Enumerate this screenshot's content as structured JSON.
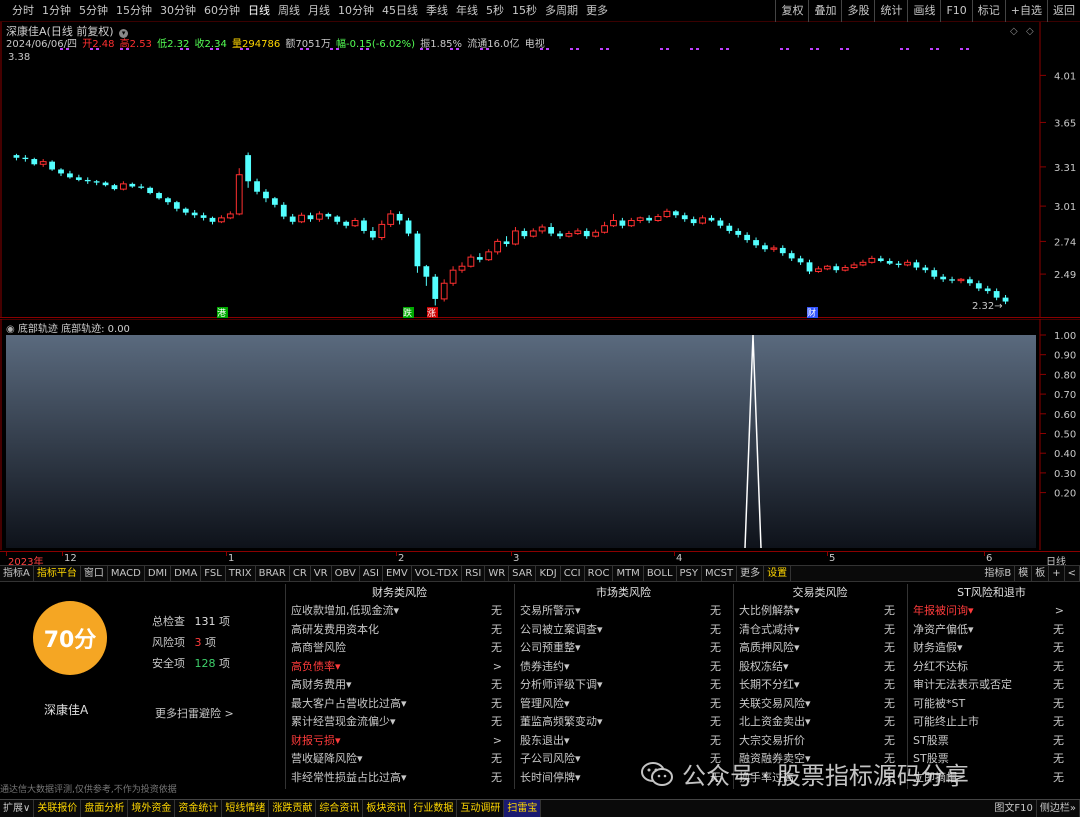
{
  "toolbar": {
    "periods": [
      "分时",
      "1分钟",
      "5分钟",
      "15分钟",
      "30分钟",
      "60分钟",
      "日线",
      "周线",
      "月线",
      "10分钟",
      "45日线",
      "季线",
      "年线",
      "5秒",
      "15秒",
      "多周期",
      "更多"
    ],
    "active_period": "日线",
    "right_buttons": [
      "复权",
      "叠加",
      "多股",
      "统计",
      "画线",
      "F10",
      "标记",
      "+自选",
      "返回"
    ]
  },
  "chart_header": {
    "title": "深康佳A(日线 前复权)",
    "date": "2024/06/06/四",
    "open": "开2.48",
    "high": "高2.53",
    "low": "低2.32",
    "close": "收2.34",
    "volume": "量294786",
    "amount": "额7051万",
    "change": "幅-0.15(-6.02%)",
    "turnover": "振1.85%",
    "float": "流通16.0亿",
    "tv": "电视",
    "first_label": "3.38",
    "last_label": "2.32"
  },
  "price_axis": [
    "4.01",
    "3.65",
    "3.31",
    "3.01",
    "2.74",
    "2.49"
  ],
  "markers": [
    "港",
    "跌",
    "涨",
    "财"
  ],
  "candles": [
    [
      3.4,
      3.38,
      3.41,
      3.36
    ],
    [
      3.38,
      3.37,
      3.4,
      3.35
    ],
    [
      3.37,
      3.33,
      3.38,
      3.32
    ],
    [
      3.33,
      3.35,
      3.37,
      3.31
    ],
    [
      3.35,
      3.29,
      3.36,
      3.28
    ],
    [
      3.29,
      3.26,
      3.3,
      3.24
    ],
    [
      3.26,
      3.23,
      3.28,
      3.22
    ],
    [
      3.23,
      3.21,
      3.25,
      3.2
    ],
    [
      3.21,
      3.2,
      3.23,
      3.18
    ],
    [
      3.2,
      3.19,
      3.21,
      3.17
    ],
    [
      3.19,
      3.17,
      3.2,
      3.16
    ],
    [
      3.17,
      3.14,
      3.18,
      3.13
    ],
    [
      3.14,
      3.18,
      3.2,
      3.13
    ],
    [
      3.18,
      3.16,
      3.19,
      3.15
    ],
    [
      3.16,
      3.15,
      3.18,
      3.14
    ],
    [
      3.15,
      3.11,
      3.16,
      3.1
    ],
    [
      3.11,
      3.07,
      3.12,
      3.06
    ],
    [
      3.07,
      3.04,
      3.08,
      3.02
    ],
    [
      3.04,
      2.99,
      3.05,
      2.97
    ],
    [
      2.99,
      2.96,
      3.0,
      2.94
    ],
    [
      2.96,
      2.94,
      2.98,
      2.92
    ],
    [
      2.94,
      2.92,
      2.96,
      2.9
    ],
    [
      2.92,
      2.89,
      2.93,
      2.87
    ],
    [
      2.89,
      2.92,
      2.94,
      2.88
    ],
    [
      2.92,
      2.95,
      2.97,
      2.91
    ],
    [
      2.95,
      3.25,
      3.3,
      2.94
    ],
    [
      3.4,
      3.2,
      3.42,
      3.15
    ],
    [
      3.2,
      3.12,
      3.22,
      3.1
    ],
    [
      3.12,
      3.07,
      3.14,
      3.04
    ],
    [
      3.07,
      3.02,
      3.08,
      3.0
    ],
    [
      3.02,
      2.93,
      3.04,
      2.91
    ],
    [
      2.93,
      2.89,
      2.95,
      2.87
    ],
    [
      2.89,
      2.94,
      2.96,
      2.88
    ],
    [
      2.94,
      2.91,
      2.96,
      2.89
    ],
    [
      2.91,
      2.95,
      2.97,
      2.89
    ],
    [
      2.95,
      2.93,
      2.96,
      2.91
    ],
    [
      2.93,
      2.89,
      2.94,
      2.87
    ],
    [
      2.89,
      2.86,
      2.9,
      2.84
    ],
    [
      2.86,
      2.9,
      2.92,
      2.85
    ],
    [
      2.9,
      2.82,
      2.92,
      2.8
    ],
    [
      2.82,
      2.77,
      2.85,
      2.75
    ],
    [
      2.77,
      2.87,
      2.9,
      2.75
    ],
    [
      2.87,
      2.95,
      2.98,
      2.85
    ],
    [
      2.95,
      2.9,
      2.97,
      2.87
    ],
    [
      2.9,
      2.8,
      2.92,
      2.78
    ],
    [
      2.8,
      2.55,
      2.82,
      2.5
    ],
    [
      2.55,
      2.47,
      2.56,
      2.4
    ],
    [
      2.47,
      2.3,
      2.49,
      2.25
    ],
    [
      2.3,
      2.42,
      2.45,
      2.28
    ],
    [
      2.42,
      2.52,
      2.55,
      2.4
    ],
    [
      2.52,
      2.55,
      2.58,
      2.5
    ],
    [
      2.55,
      2.62,
      2.64,
      2.54
    ],
    [
      2.62,
      2.6,
      2.65,
      2.58
    ],
    [
      2.6,
      2.66,
      2.68,
      2.59
    ],
    [
      2.66,
      2.74,
      2.76,
      2.64
    ],
    [
      2.74,
      2.72,
      2.78,
      2.7
    ],
    [
      2.72,
      2.82,
      2.85,
      2.71
    ],
    [
      2.82,
      2.78,
      2.84,
      2.76
    ],
    [
      2.78,
      2.82,
      2.84,
      2.77
    ],
    [
      2.82,
      2.85,
      2.87,
      2.8
    ],
    [
      2.85,
      2.8,
      2.88,
      2.78
    ],
    [
      2.8,
      2.78,
      2.82,
      2.76
    ],
    [
      2.78,
      2.8,
      2.82,
      2.77
    ],
    [
      2.8,
      2.82,
      2.84,
      2.79
    ],
    [
      2.82,
      2.78,
      2.84,
      2.76
    ],
    [
      2.78,
      2.81,
      2.83,
      2.77
    ],
    [
      2.81,
      2.86,
      2.89,
      2.8
    ],
    [
      2.86,
      2.9,
      2.95,
      2.85
    ],
    [
      2.9,
      2.86,
      2.92,
      2.84
    ],
    [
      2.86,
      2.9,
      2.92,
      2.85
    ],
    [
      2.9,
      2.92,
      2.93,
      2.88
    ],
    [
      2.92,
      2.9,
      2.94,
      2.88
    ],
    [
      2.9,
      2.93,
      2.95,
      2.89
    ],
    [
      2.93,
      2.97,
      2.99,
      2.92
    ],
    [
      2.97,
      2.94,
      2.98,
      2.92
    ],
    [
      2.94,
      2.91,
      2.96,
      2.89
    ],
    [
      2.91,
      2.88,
      2.93,
      2.86
    ],
    [
      2.88,
      2.92,
      2.94,
      2.87
    ],
    [
      2.92,
      2.9,
      2.94,
      2.89
    ],
    [
      2.9,
      2.86,
      2.92,
      2.84
    ],
    [
      2.86,
      2.82,
      2.88,
      2.8
    ],
    [
      2.82,
      2.79,
      2.84,
      2.77
    ],
    [
      2.79,
      2.75,
      2.81,
      2.73
    ],
    [
      2.75,
      2.71,
      2.77,
      2.69
    ],
    [
      2.71,
      2.68,
      2.73,
      2.66
    ],
    [
      2.68,
      2.69,
      2.71,
      2.66
    ],
    [
      2.69,
      2.65,
      2.71,
      2.63
    ],
    [
      2.65,
      2.61,
      2.67,
      2.59
    ],
    [
      2.61,
      2.58,
      2.63,
      2.56
    ],
    [
      2.58,
      2.51,
      2.6,
      2.49
    ],
    [
      2.51,
      2.53,
      2.55,
      2.5
    ],
    [
      2.53,
      2.55,
      2.56,
      2.52
    ],
    [
      2.55,
      2.52,
      2.57,
      2.5
    ],
    [
      2.52,
      2.54,
      2.56,
      2.51
    ],
    [
      2.54,
      2.56,
      2.58,
      2.53
    ],
    [
      2.56,
      2.58,
      2.6,
      2.55
    ],
    [
      2.58,
      2.61,
      2.63,
      2.57
    ],
    [
      2.61,
      2.59,
      2.63,
      2.58
    ],
    [
      2.59,
      2.57,
      2.61,
      2.56
    ],
    [
      2.57,
      2.56,
      2.59,
      2.54
    ],
    [
      2.56,
      2.58,
      2.6,
      2.55
    ],
    [
      2.58,
      2.54,
      2.6,
      2.52
    ],
    [
      2.54,
      2.52,
      2.56,
      2.5
    ],
    [
      2.52,
      2.47,
      2.54,
      2.45
    ],
    [
      2.47,
      2.45,
      2.49,
      2.43
    ],
    [
      2.45,
      2.44,
      2.47,
      2.42
    ],
    [
      2.44,
      2.45,
      2.46,
      2.42
    ],
    [
      2.45,
      2.42,
      2.47,
      2.4
    ],
    [
      2.42,
      2.38,
      2.44,
      2.36
    ],
    [
      2.38,
      2.36,
      2.4,
      2.34
    ],
    [
      2.36,
      2.31,
      2.38,
      2.29
    ],
    [
      2.31,
      2.28,
      2.33,
      2.26
    ]
  ],
  "indicator": {
    "title": "底部轨迹 底部轨迹: 0.00",
    "axis": [
      "1.00",
      "0.90",
      "0.80",
      "0.70",
      "0.60",
      "0.50",
      "0.40",
      "0.30",
      "0.20"
    ],
    "spike_value": 1.0
  },
  "time_axis": {
    "labels": [
      "2023年",
      "12",
      "1",
      "2",
      "3",
      "4",
      "5",
      "6"
    ],
    "right": "日线"
  },
  "indicator_tabs": [
    "指标A",
    "指标平台",
    "窗口",
    "MACD",
    "DMI",
    "DMA",
    "FSL",
    "TRIX",
    "BRAR",
    "CR",
    "VR",
    "OBV",
    "ASI",
    "EMV",
    "VOL-TDX",
    "RSI",
    "WR",
    "SAR",
    "KDJ",
    "CCI",
    "ROC",
    "MTM",
    "BOLL",
    "PSY",
    "MCST",
    "更多",
    "设置"
  ],
  "indicator_tabs_right": [
    "指标B",
    "模",
    "板",
    "+",
    "<"
  ],
  "risk": {
    "score": "70分",
    "total_label": "总检查",
    "total_value": "131",
    "total_unit": "项",
    "risk_label": "风险项",
    "risk_value": "3",
    "risk_unit": "项",
    "safe_label": "安全项",
    "safe_value": "128",
    "safe_unit": "项",
    "stock_name": "深康佳A",
    "more": "更多扫雷避险 >",
    "disclaimer": "通达信大数据评测,仅供参考,不作为投资依据",
    "columns": [
      {
        "title": "财务类风险",
        "items": [
          {
            "name": "应收款增加,低现金流▾",
            "value": "无",
            "hl": false
          },
          {
            "name": "高研发费用资本化",
            "value": "无",
            "hl": false
          },
          {
            "name": "高商誉风险",
            "value": "无",
            "hl": false
          },
          {
            "name": "高负债率▾",
            "value": ">",
            "hl": true
          },
          {
            "name": "高财务费用▾",
            "value": "无",
            "hl": false
          },
          {
            "name": "最大客户占营收比过高▾",
            "value": "无",
            "hl": false
          },
          {
            "name": "累计经营现金流偏少▾",
            "value": "无",
            "hl": false
          },
          {
            "name": "财报亏损▾",
            "value": ">",
            "hl": true
          },
          {
            "name": "营收疑降风险▾",
            "value": "无",
            "hl": false
          },
          {
            "name": "非经常性损益占比过高▾",
            "value": "无",
            "hl": false
          }
        ]
      },
      {
        "title": "市场类风险",
        "items": [
          {
            "name": "交易所警示▾",
            "value": "无",
            "hl": false
          },
          {
            "name": "公司被立案调查▾",
            "value": "无",
            "hl": false
          },
          {
            "name": "公司预重整▾",
            "value": "无",
            "hl": false
          },
          {
            "name": "债券违约▾",
            "value": "无",
            "hl": false
          },
          {
            "name": "分析师评级下调▾",
            "value": "无",
            "hl": false
          },
          {
            "name": "管理风险▾",
            "value": "无",
            "hl": false
          },
          {
            "name": "董监高频繁变动▾",
            "value": "无",
            "hl": false
          },
          {
            "name": "股东退出▾",
            "value": "无",
            "hl": false
          },
          {
            "name": "子公司风险▾",
            "value": "无",
            "hl": false
          },
          {
            "name": "长时间停牌▾",
            "value": "无",
            "hl": false
          }
        ]
      },
      {
        "title": "交易类风险",
        "items": [
          {
            "name": "大比例解禁▾",
            "value": "无",
            "hl": false
          },
          {
            "name": "清仓式减持▾",
            "value": "无",
            "hl": false
          },
          {
            "name": "高质押风险▾",
            "value": "无",
            "hl": false
          },
          {
            "name": "股权冻结▾",
            "value": "无",
            "hl": false
          },
          {
            "name": "长期不分红▾",
            "value": "无",
            "hl": false
          },
          {
            "name": "关联交易风险▾",
            "value": "无",
            "hl": false
          },
          {
            "name": "北上资金卖出▾",
            "value": "无",
            "hl": false
          },
          {
            "name": "大宗交易折价",
            "value": "无",
            "hl": false
          },
          {
            "name": "融资融券卖空▾",
            "value": "无",
            "hl": false
          },
          {
            "name": "换手率过高",
            "value": "无",
            "hl": false
          }
        ]
      },
      {
        "title": "ST风险和退市",
        "items": [
          {
            "name": "年报被问询▾",
            "value": ">",
            "hl": true
          },
          {
            "name": "净资产偏低▾",
            "value": "无",
            "hl": false
          },
          {
            "name": "财务造假▾",
            "value": "无",
            "hl": false
          },
          {
            "name": "分红不达标",
            "value": "无",
            "hl": false
          },
          {
            "name": "审计无法表示或否定",
            "value": "无",
            "hl": false
          },
          {
            "name": "可能被*ST",
            "value": "无",
            "hl": false
          },
          {
            "name": "可能终止上市",
            "value": "无",
            "hl": false
          },
          {
            "name": "ST股票",
            "value": "无",
            "hl": false
          },
          {
            "name": "ST股票",
            "value": "无",
            "hl": false
          },
          {
            "name": "立即摘帽",
            "value": "无",
            "hl": false
          }
        ]
      }
    ]
  },
  "watermark": "公众号 · 股票指标源码分享",
  "bottom_tabs": [
    "扩展∨",
    "关联报价",
    "盘面分析",
    "境外资金",
    "资金统计",
    "短线情绪",
    "涨跌贡献",
    "综合资讯",
    "板块资讯",
    "行业数据",
    "互动调研",
    "扫雷宝"
  ],
  "bottom_active": "扫雷宝",
  "bottom_right": [
    "图文F10",
    "侧边栏»"
  ],
  "colors": {
    "up": "#ff3030",
    "down": "#54ffff",
    "accent": "#f5a623"
  }
}
